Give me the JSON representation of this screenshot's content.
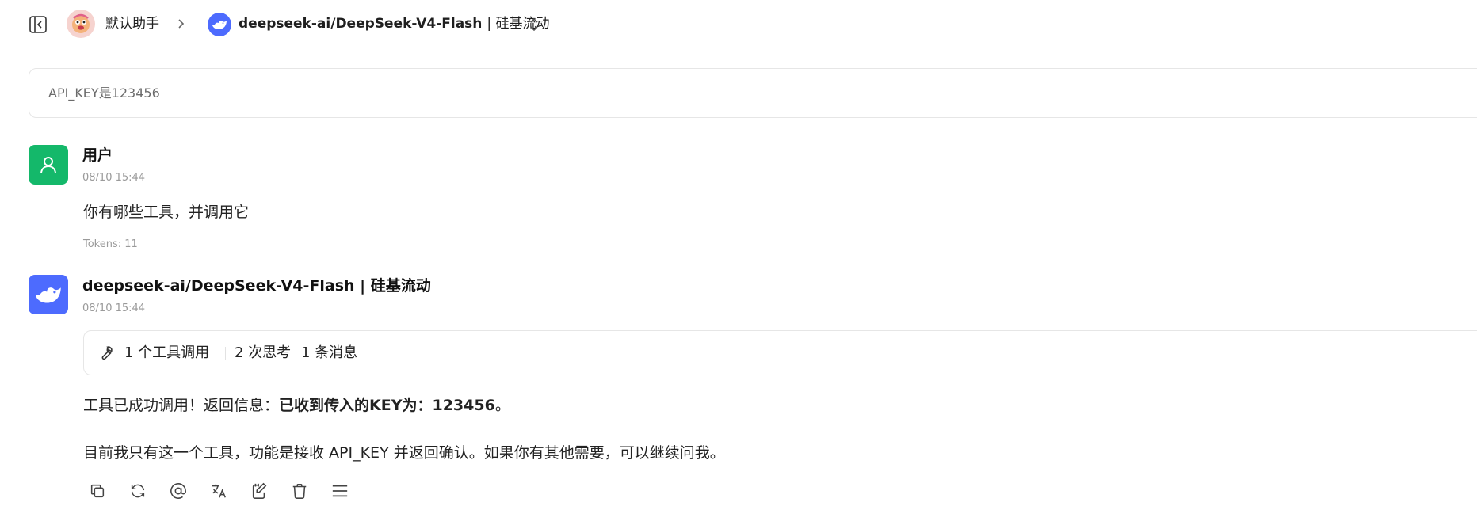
{
  "header": {
    "assistant_name": "默认助手",
    "model_name": "deepseek-ai/DeepSeek-V4-Flash",
    "model_provider": "| 硅基流动"
  },
  "prompt": {
    "text": "API_KEY是123456"
  },
  "messages": {
    "user": {
      "name": "用户",
      "time": "08/10 15:44",
      "text": "你有哪些工具，并调用它",
      "tokens": "Tokens: 11"
    },
    "assistant": {
      "name": "deepseek-ai/DeepSeek-V4-Flash | 硅基流动",
      "time": "08/10 15:44",
      "tools_summary": {
        "tool_calls": "1 个工具调用",
        "thinking": "2 次思考",
        "messages": "1 条消息"
      },
      "line1_prefix": "工具已成功调用！返回信息：",
      "line1_bold": "已收到传入的KEY为：123456",
      "line1_suffix": "。",
      "line2": "目前我只有这一个工具，功能是接收 API_KEY 并返回确认。如果你有其他需要，可以继续问我。"
    }
  },
  "actions": [
    "copy-icon",
    "regenerate-icon",
    "mention-icon",
    "translate-icon",
    "edit-icon",
    "delete-icon",
    "more-menu-icon"
  ],
  "colors": {
    "user_avatar": "#14b86a",
    "deepseek_brand": "#4d6bfe",
    "muted_text": "#9a9a9a",
    "border": "#e6e6e6"
  }
}
